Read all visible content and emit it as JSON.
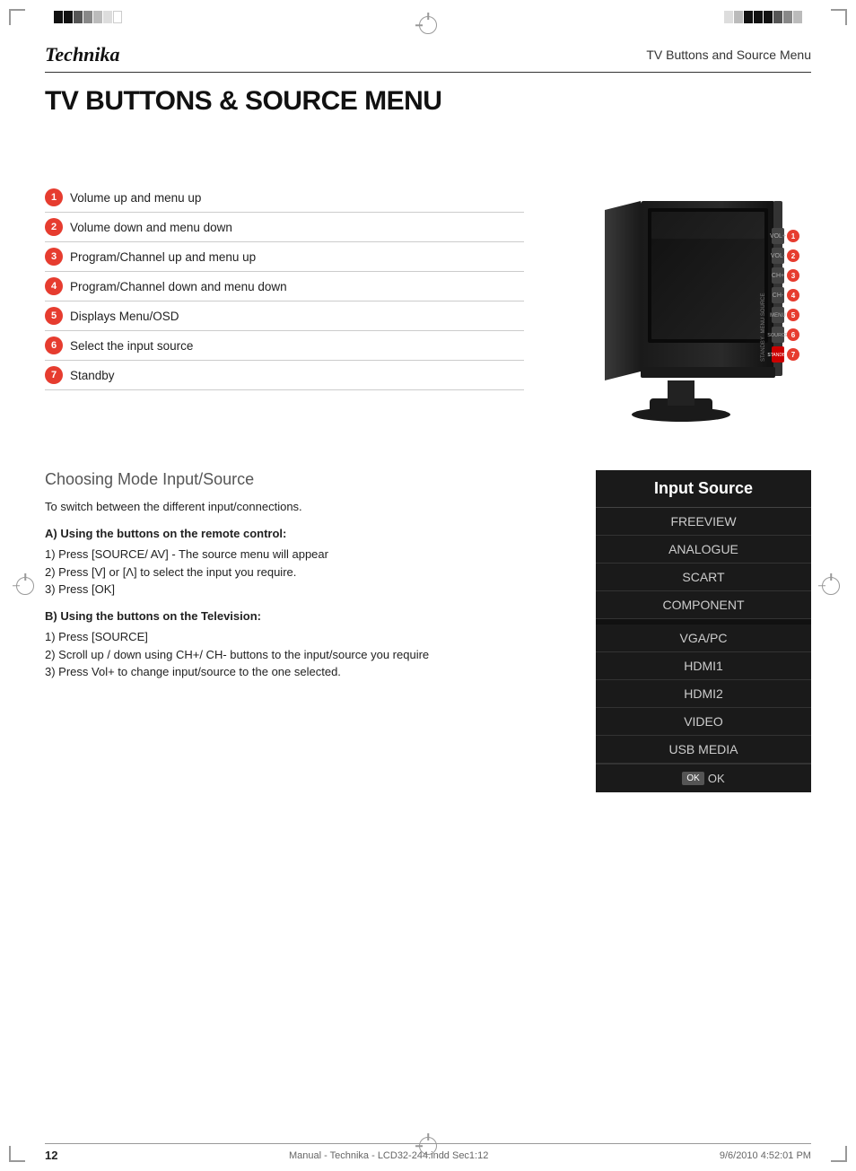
{
  "header": {
    "brand": "Technika",
    "title": "TV Buttons and Source Menu"
  },
  "page_title": "TV BUTTONS & SOURCE MENU",
  "buttons_list": {
    "items": [
      {
        "num": "1",
        "label": "Volume up and menu up"
      },
      {
        "num": "2",
        "label": "Volume down and menu down"
      },
      {
        "num": "3",
        "label": "Program/Channel up and menu up"
      },
      {
        "num": "4",
        "label": "Program/Channel down and menu down"
      },
      {
        "num": "5",
        "label": "Displays Menu/OSD"
      },
      {
        "num": "6",
        "label": "Select the input source"
      },
      {
        "num": "7",
        "label": "Standby"
      }
    ]
  },
  "choosing_mode": {
    "title": "Choosing Mode Input/Source",
    "intro": "To switch between the different input/connections.",
    "section_a_heading": "A) Using the buttons on the remote control:",
    "section_a_steps": "1) Press [SOURCE/ AV] - The source menu will appear\n2) Press [V] or [Λ] to select the input you require.\n3) Press [OK]",
    "section_b_heading": "B) Using the buttons on the Television:",
    "section_b_steps": "1) Press [SOURCE]\n2) Scroll up / down using CH+/ CH- buttons to the input/source you require\n3) Press Vol+ to change input/source to the one selected."
  },
  "input_source": {
    "title": "Input Source",
    "items": [
      "FREEVIEW",
      "ANALOGUE",
      "SCART",
      "COMPONENT",
      "VGA/PC",
      "HDMI1",
      "HDMI2",
      "VIDEO",
      "USB MEDIA"
    ],
    "ok_label": "OK"
  },
  "footer": {
    "page_number": "12",
    "file_info": "Manual - Technika - LCD32-244.indd   Sec1:12",
    "timestamp": "9/6/2010   4:52:01 PM"
  }
}
